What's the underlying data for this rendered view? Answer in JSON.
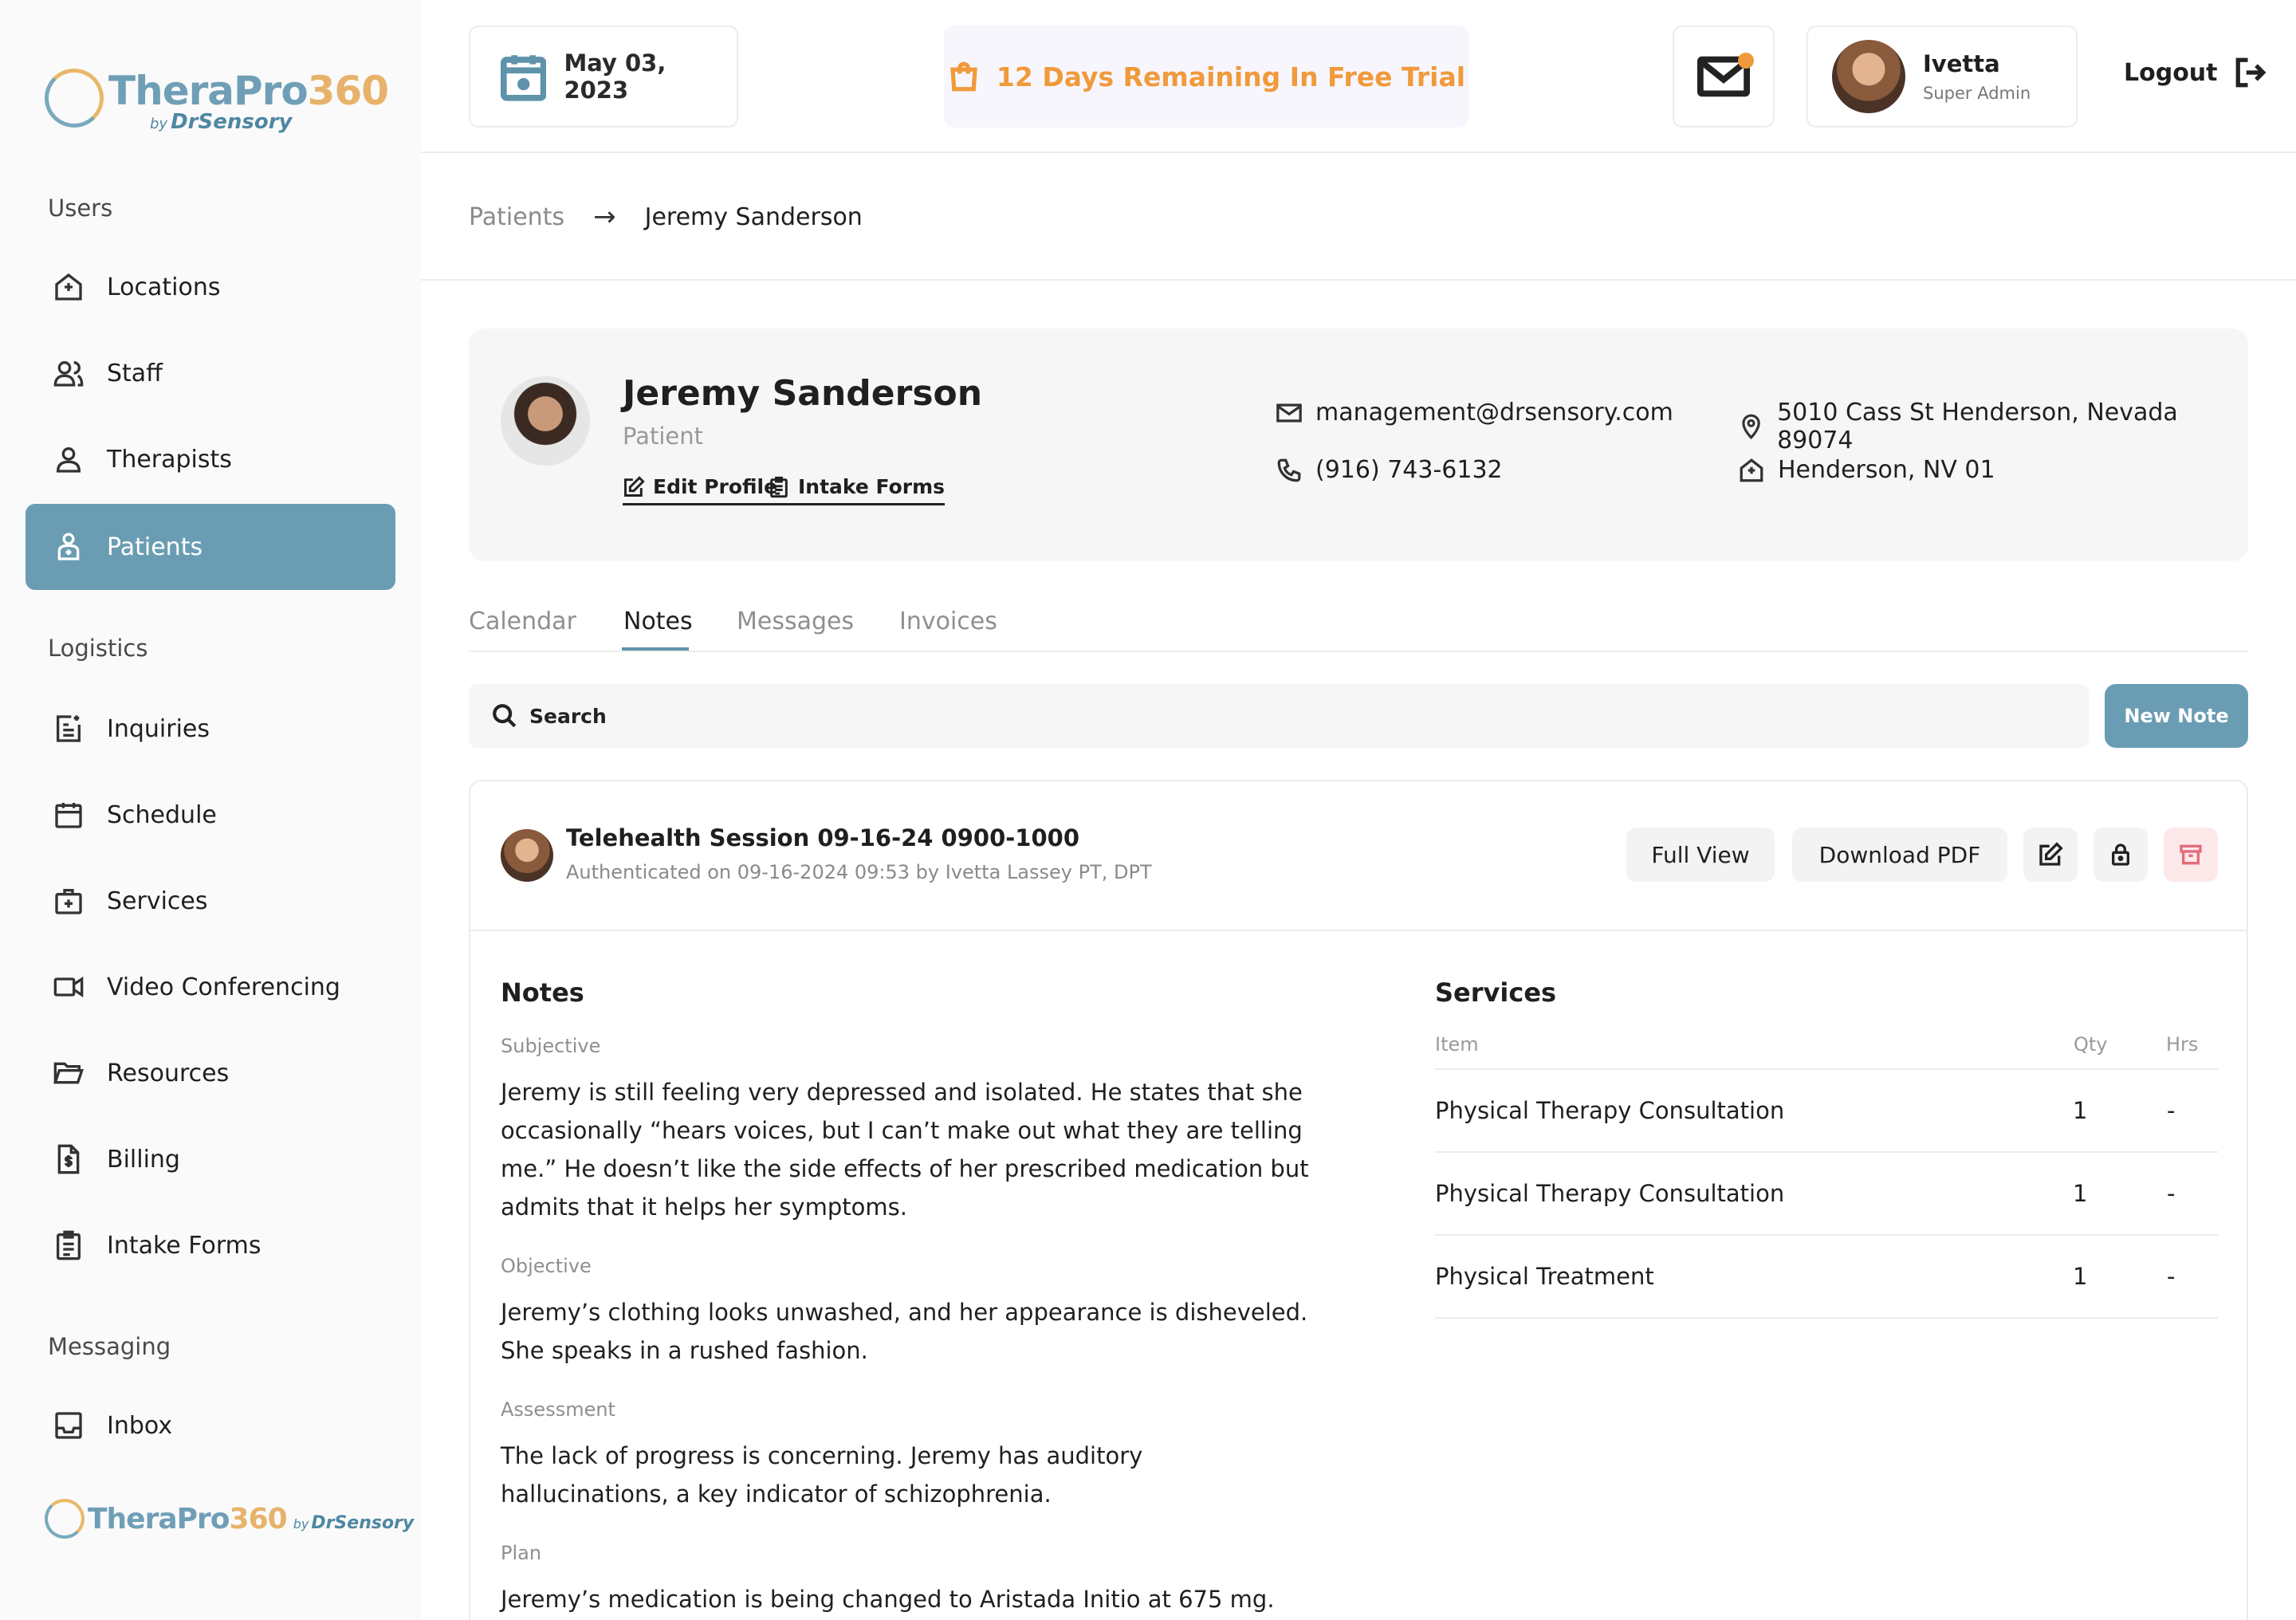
{
  "brand": {
    "logo_part1": "TheraPro",
    "logo_part2": "360",
    "by": "by",
    "sub": "DrSensory"
  },
  "sidebar": {
    "sections": [
      {
        "label": "Users"
      },
      {
        "label": "Logistics"
      },
      {
        "label": "Messaging"
      }
    ],
    "items": [
      {
        "label": "Locations",
        "icon": "location-house-icon"
      },
      {
        "label": "Staff",
        "icon": "staff-icon"
      },
      {
        "label": "Therapists",
        "icon": "user-icon"
      },
      {
        "label": "Patients",
        "icon": "patient-icon",
        "active": true
      },
      {
        "label": "Inquiries",
        "icon": "inquiries-icon"
      },
      {
        "label": "Schedule",
        "icon": "calendar-icon"
      },
      {
        "label": "Services",
        "icon": "medical-bag-icon"
      },
      {
        "label": "Video Conferencing",
        "icon": "video-icon"
      },
      {
        "label": "Resources",
        "icon": "folder-icon"
      },
      {
        "label": "Billing",
        "icon": "billing-icon"
      },
      {
        "label": "Intake Forms",
        "icon": "clipboard-icon"
      },
      {
        "label": "Inbox",
        "icon": "inbox-icon"
      }
    ]
  },
  "header": {
    "date": "May 03, 2023",
    "trial": "12 Days Remaining In Free Trial",
    "user_name": "Ivetta",
    "user_role": "Super Admin",
    "logout": "Logout"
  },
  "breadcrumb": {
    "parent": "Patients",
    "arrow": "→",
    "current": "Jeremy Sanderson"
  },
  "patient": {
    "name": "Jeremy Sanderson",
    "role": "Patient",
    "edit_profile": "Edit Profile",
    "intake_forms": "Intake Forms",
    "email": "management@drsensory.com",
    "phone": "(916) 743-6132",
    "address": "5010 Cass St Henderson, Nevada 89074",
    "location": "Henderson, NV 01"
  },
  "tabs": [
    {
      "label": "Calendar"
    },
    {
      "label": "Notes",
      "active": true
    },
    {
      "label": "Messages"
    },
    {
      "label": "Invoices"
    }
  ],
  "search": {
    "placeholder": "Search"
  },
  "new_note": "New Note",
  "note": {
    "title": "Telehealth Session 09-16-24 0900-1000",
    "subtitle": "Authenticated on 09-16-2024 09:53 by Ivetta Lassey PT, DPT",
    "full_view": "Full View",
    "download_pdf": "Download PDF",
    "notes_title": "Notes",
    "subjective_label": "Subjective",
    "subjective": "Jeremy is still feeling very depressed and isolated. He states that she occasionally “hears voices, but I can’t make out what they are telling me.” He doesn’t like the side effects of her prescribed medication but admits that it helps her symptoms.",
    "objective_label": "Objective",
    "objective": "Jeremy’s clothing looks unwashed, and her appearance is disheveled. She speaks in a rushed fashion.",
    "assessment_label": "Assessment",
    "assessment": "The lack of progress is concerning. Jeremy has auditory hallucinations, a key indicator of schizophrenia.",
    "plan_label": "Plan",
    "plan": "Jeremy’s medication is being changed to Aristada Initio at 675 mg.",
    "services_title": "Services",
    "services_headers": {
      "item": "Item",
      "qty": "Qty",
      "hrs": "Hrs"
    },
    "services": [
      {
        "item": "Physical Therapy Consultation",
        "qty": "1",
        "hrs": "-"
      },
      {
        "item": "Physical Therapy Consultation",
        "qty": "1",
        "hrs": "-"
      },
      {
        "item": "Physical Treatment",
        "qty": "1",
        "hrs": "-"
      }
    ]
  },
  "colors": {
    "accent": "#6a9db3",
    "trial_orange": "#f09a3b",
    "danger_bg": "#fde8ea"
  }
}
